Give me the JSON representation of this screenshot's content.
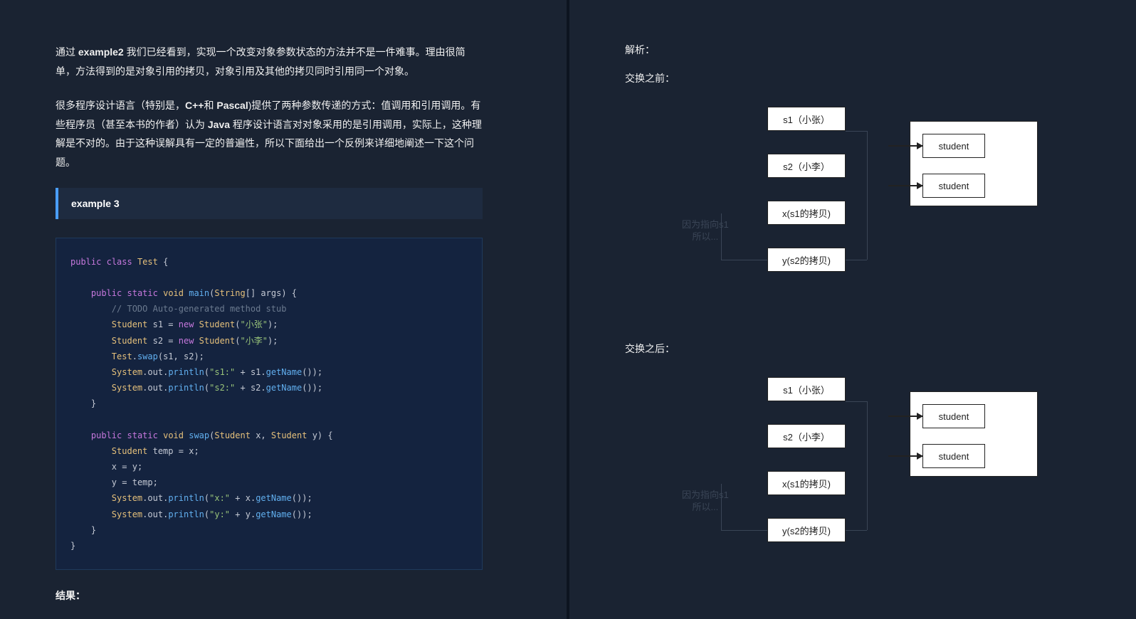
{
  "left": {
    "p1_a": "通过 ",
    "p1_b": "example2",
    "p1_c": " 我们已经看到，实现一个改变对象参数状态的方法并不是一件难事。理由很简单，方法得到的是对象引用的拷贝，对象引用及其他的拷贝同时引用同一个对象。",
    "p2_a": "很多程序设计语言（特别是，",
    "p2_b": "C++",
    "p2_c": "和 ",
    "p2_d": "Pascal",
    "p2_e": ")提供了两种参数传递的方式：值调用和引用调用。有些程序员（甚至本书的作者）认为 ",
    "p2_f": "Java",
    "p2_g": " 程序设计语言对对象采用的是引用调用，实际上，这种理解是不对的。由于这种误解具有一定的普遍性，所以下面给出一个反例来详细地阐述一下这个问题。",
    "callout": "example 3",
    "code": {
      "kw_public": "public",
      "kw_class": "class",
      "kw_static": "static",
      "kw_void": "void",
      "kw_new": "new",
      "cls_Test": "Test",
      "cls_Student": "Student",
      "cls_String": "String",
      "cls_System": "System",
      "fn_main": "main",
      "fn_swap": "swap",
      "fn_println": "println",
      "fn_getName": "getName",
      "id_args": "args",
      "id_s1": "s1",
      "id_s2": "s2",
      "id_x": "x",
      "id_y": "y",
      "id_temp": "temp",
      "id_out": "out",
      "cmt": "// TODO Auto-generated method stub",
      "str_zhang": "\"小张\"",
      "str_li": "\"小李\"",
      "str_s1": "\"s1:\"",
      "str_s2": "\"s2:\"",
      "str_x": "\"x:\"",
      "str_y": "\"y:\""
    },
    "result_label": "结果："
  },
  "right": {
    "analysis": "解析：",
    "before_label": "交换之前：",
    "after_label": "交换之后：",
    "boxes": {
      "s1": "s1（小张）",
      "s2": "s2（小李）",
      "xcopy": "x(s1的拷贝)",
      "ycopy": "y(s2的拷贝)",
      "student": "student"
    },
    "faded_before_l1": "因为指向s1",
    "faded_before_l2": "所以...",
    "faded_after_l1": "因为指向s1",
    "faded_after_l2": "所以..."
  }
}
